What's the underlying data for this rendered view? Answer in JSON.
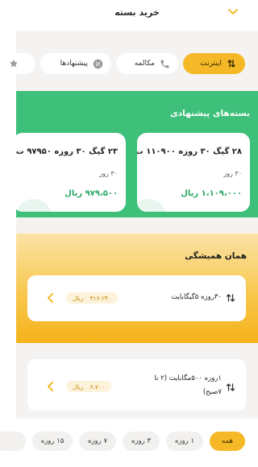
{
  "header": {
    "title": "خرید بسته"
  },
  "categories": [
    {
      "label": "اینترنت",
      "icon": "data-arrows-icon",
      "active": true
    },
    {
      "label": "مکالمه",
      "icon": "phone-icon",
      "active": false
    },
    {
      "label": "پیشنهادها",
      "icon": "discount-badge-icon",
      "active": false
    },
    {
      "label": "",
      "icon": "star-icon",
      "active": false
    }
  ],
  "suggested": {
    "title": "بسته‌های پیشنهادی",
    "cards": [
      {
        "name": "۲۸ گیگ ۳۰ روزه ۱۱۰۹۰۰ ت",
        "duration": "۳۰ روز",
        "price": "۱،۱۰۹،۰۰۰ ریال"
      },
      {
        "name": "۲۳ گیگ ۳۰ روزه ۹۷۹۵۰ ت",
        "duration": "۳۰ روز",
        "price": "۹۷۹،۵۰۰ ریال"
      }
    ]
  },
  "always": {
    "title": "همان همیشگی",
    "offers": [
      {
        "name": "۳۰روزه ۵گیگابایت",
        "price": "۳۱۶،۲۴۰",
        "currency": "ریال"
      },
      {
        "name": "۱روزه ۵۰۰مگابایت (۲ تا ۷صبح)",
        "price": "۶،۷۰۰",
        "currency": "ریال"
      }
    ]
  },
  "day_filters": [
    {
      "label": "همه",
      "active": true
    },
    {
      "label": "۱ روزه",
      "active": false
    },
    {
      "label": "۳ روزه",
      "active": false
    },
    {
      "label": "۷ روزه",
      "active": false
    },
    {
      "label": "۱۵ روزه",
      "active": false
    },
    {
      "label": "",
      "active": false
    }
  ],
  "colors": {
    "accent": "#f5b928",
    "green": "#3ec07a",
    "price_green": "#2aa863",
    "price_gold": "#c48a00"
  }
}
